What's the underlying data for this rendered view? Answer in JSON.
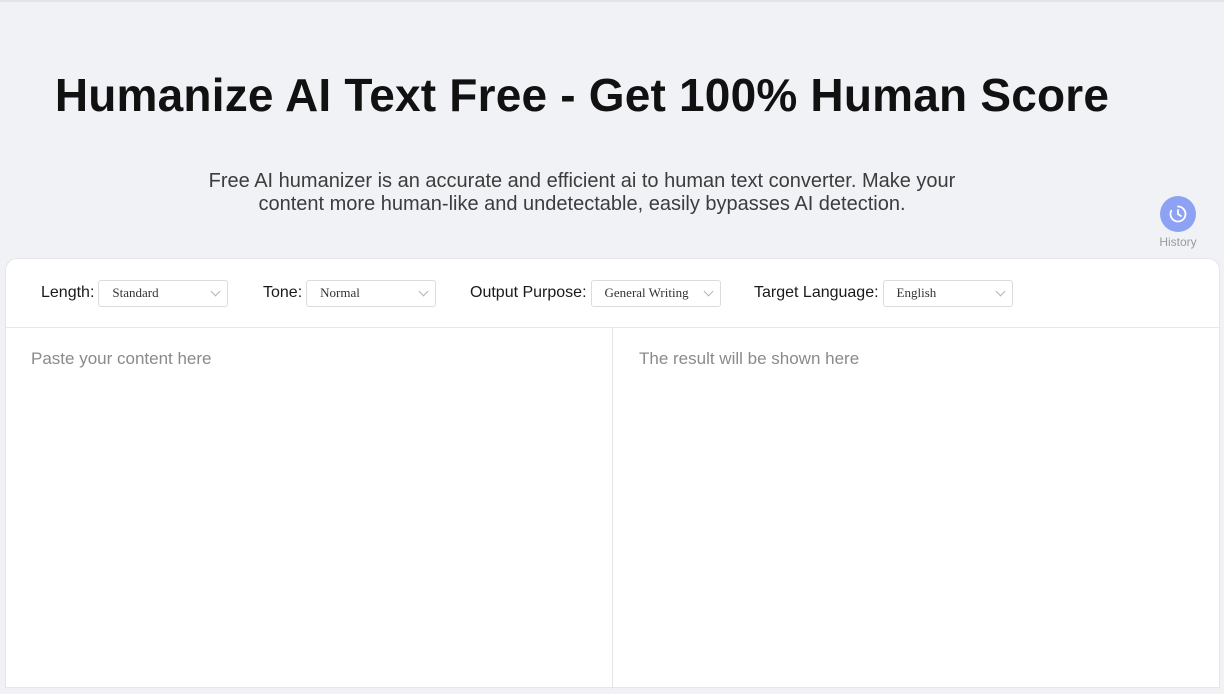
{
  "hero": {
    "title": "Humanize AI Text Free - Get 100% Human Score",
    "subtitle": "Free AI humanizer is an accurate and efficient ai to human text converter. Make your content more human-like and undetectable, easily bypasses AI detection."
  },
  "history": {
    "label": "History",
    "icon": "clock-history-icon",
    "color": "#8ea2f3"
  },
  "options": {
    "length": {
      "label": "Length:",
      "value": "Standard"
    },
    "tone": {
      "label": "Tone:",
      "value": "Normal"
    },
    "purpose": {
      "label": "Output Purpose:",
      "value": "General Writing"
    },
    "language": {
      "label": "Target Language:",
      "value": "English"
    }
  },
  "input": {
    "placeholder": "Paste your content here",
    "value": ""
  },
  "output": {
    "placeholder": "The result will be shown here"
  }
}
